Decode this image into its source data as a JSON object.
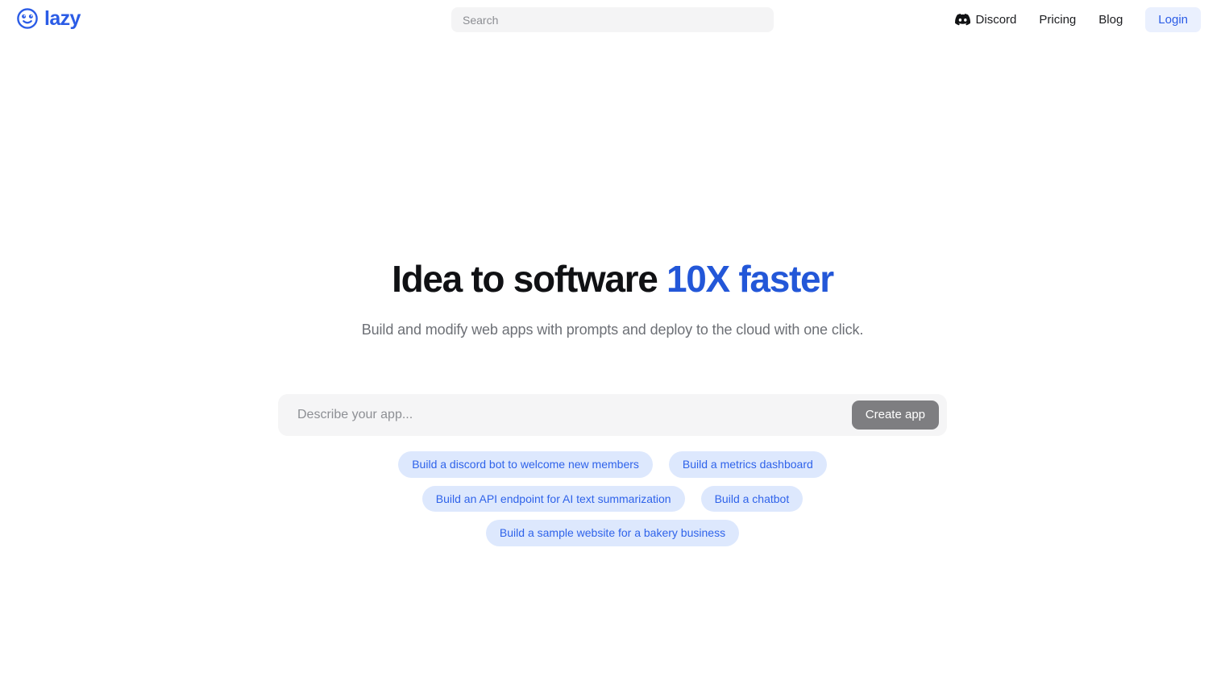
{
  "brand": {
    "name": "lazy",
    "icon": "smiley-face-icon",
    "color": "#2b5ce6"
  },
  "search": {
    "placeholder": "Search",
    "value": ""
  },
  "nav": {
    "items": [
      {
        "label": "Discord",
        "icon": "discord-icon"
      },
      {
        "label": "Pricing",
        "icon": ""
      },
      {
        "label": "Blog",
        "icon": ""
      }
    ],
    "login_label": "Login"
  },
  "hero": {
    "headline_plain": "Idea to software ",
    "headline_accent": "10X faster",
    "subheadline": "Build and modify web apps with prompts and deploy to the cloud with one click.",
    "accent_color": "#2357d8"
  },
  "composer": {
    "placeholder": "Describe your app...",
    "value": "",
    "button_label": "Create app",
    "button_color": "#7e7e81"
  },
  "suggestions": {
    "chip_bg": "#dde8fd",
    "chip_color": "#2f63ea",
    "row1": [
      "Build a discord bot to welcome new members",
      "Build a metrics dashboard"
    ],
    "row2": [
      "Build an API endpoint for AI text summarization",
      "Build a chatbot",
      "Build a sample website for a bakery business"
    ]
  }
}
